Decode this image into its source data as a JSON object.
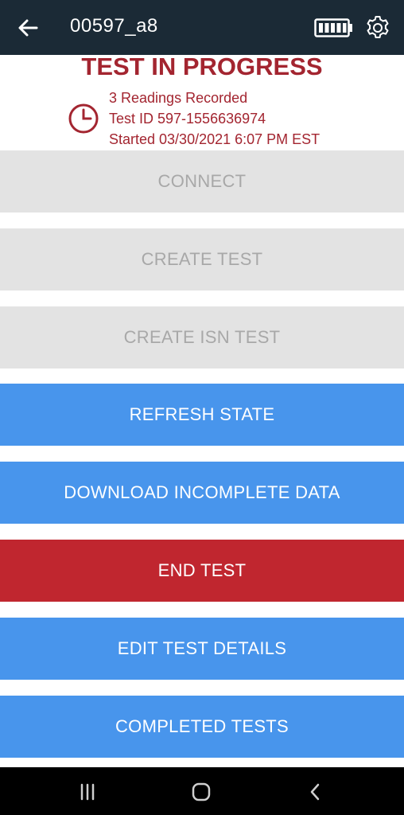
{
  "header": {
    "title": "00597_a8",
    "icons": [
      "back-arrow-icon",
      "battery-icon",
      "gear-icon"
    ],
    "background": "#1b2a36"
  },
  "status": {
    "heading": "TEST IN PROGRESS",
    "readings": "3 Readings Recorded",
    "test_id": "Test ID 597-1556636974",
    "started": "Started 03/30/2021 6:07 PM EST",
    "icon": "clock-icon",
    "color": "#a32530"
  },
  "buttons": {
    "connect": "CONNECT",
    "create_test": "CREATE TEST",
    "create_isn_test": "CREATE ISN TEST",
    "refresh_state": "REFRESH STATE",
    "download_incomplete": "DOWNLOAD INCOMPLETE DATA",
    "end_test": "END TEST",
    "edit_details": "EDIT TEST DETAILS",
    "completed_tests": "COMPLETED TESTS"
  },
  "colors": {
    "disabled_bg": "#e3e3e3",
    "disabled_text": "#a8a8a8",
    "primary": "#4895ec",
    "danger": "#c0262f"
  },
  "system_nav": {
    "icons": [
      "recent-apps-icon",
      "home-icon",
      "nav-back-icon"
    ]
  }
}
